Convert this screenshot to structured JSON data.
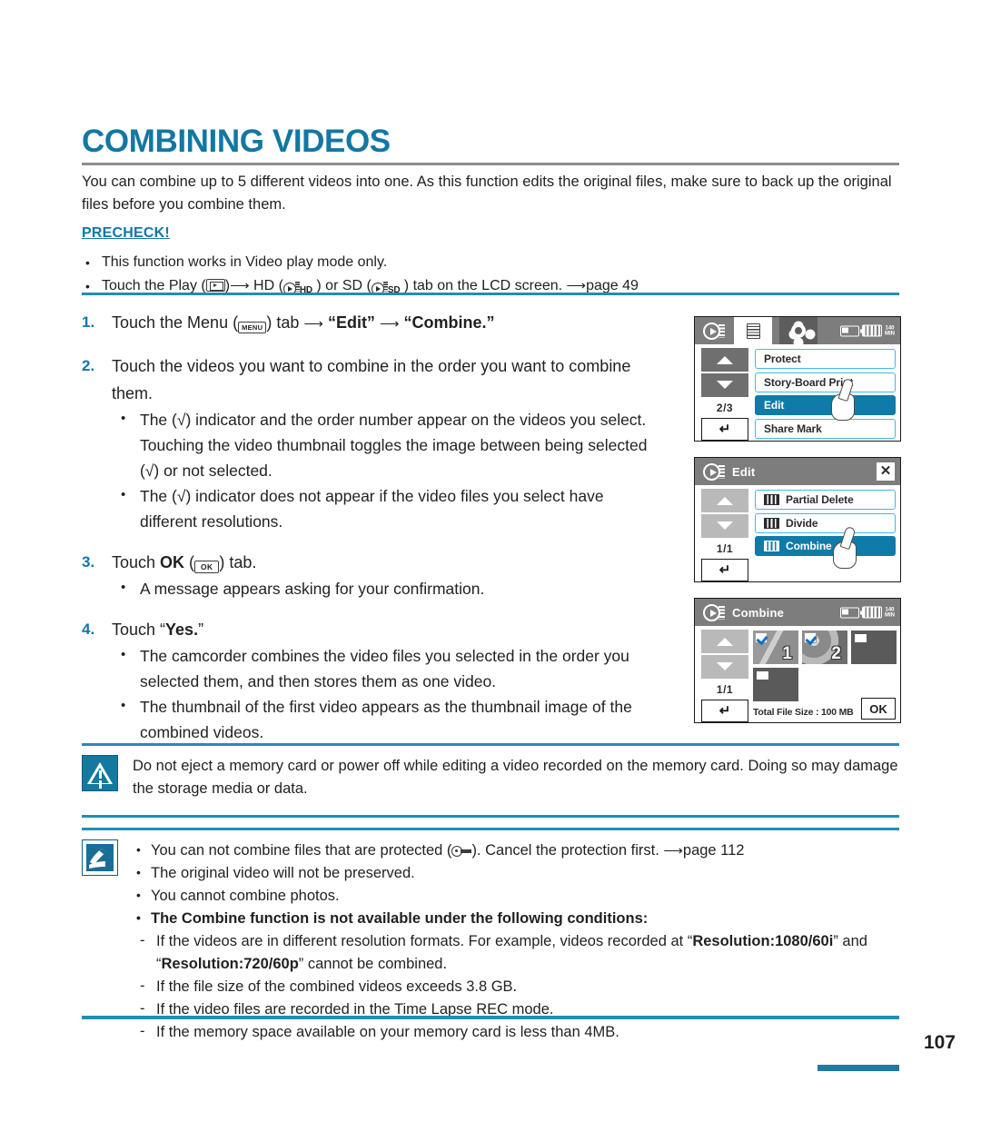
{
  "page": {
    "title": "COMBINING VIDEOS",
    "number": "107",
    "intro": "You can combine up to 5 different videos into one. As this function edits the original files, make sure to back up the original files before you combine them."
  },
  "precheck": {
    "heading": "PRECHECK!",
    "items": [
      {
        "pre": "This function works in Video play mode only.",
        "type": "plain"
      },
      {
        "type": "rich",
        "parts": [
          "Touch the Play (",
          ")",
          " HD (",
          "HD",
          " ) or SD (",
          "SD",
          " ) tab on the LCD screen. ",
          "page 49"
        ]
      }
    ],
    "line1": "This function works in Video play mode only."
  },
  "steps": [
    {
      "num": "1.",
      "text_a": "Touch the Menu (",
      "menu_icon_label": "MENU",
      "text_b": ") tab ",
      "bold_a": "“Edit”",
      "text_c": " ",
      "bold_b": "“Combine.”"
    },
    {
      "num": "2.",
      "text": "Touch the videos you want to combine in the order you want to combine them.",
      "bullets": [
        "The (√) indicator and the order number appear on the videos you select. Touching the video thumbnail toggles the image between being selected (√) or not selected.",
        "The (√) indicator does not appear if the video files you select have different resolutions."
      ]
    },
    {
      "num": "3.",
      "text_a": "Touch ",
      "bold_a": "OK",
      "text_b": " (",
      "ok_icon_label": "OK",
      "text_c": ") tab.",
      "bullets": [
        "A message appears asking for your confirmation."
      ]
    },
    {
      "num": "4.",
      "text_a": "Touch “",
      "bold_a": "Yes.",
      "text_b": "”",
      "bullets": [
        "The camcorder combines the video files you selected in the order you selected them, and then stores them as one video.",
        "The thumbnail of the first video appears as the thumbnail image of the combined videos."
      ]
    }
  ],
  "screens": [
    {
      "id": "menu-screen",
      "title": "",
      "page_indicator": "2/3",
      "items": [
        {
          "label": "Protect",
          "selected": false,
          "icon": false
        },
        {
          "label": "Story-Board Print",
          "selected": false,
          "icon": false
        },
        {
          "label": "Edit",
          "selected": true,
          "icon": false
        },
        {
          "label": "Share Mark",
          "selected": false,
          "icon": false
        }
      ],
      "memory_time": "140 MIN"
    },
    {
      "id": "edit-screen",
      "title": "Edit",
      "page_indicator": "1/1",
      "items": [
        {
          "label": "Partial Delete",
          "selected": false,
          "icon": true
        },
        {
          "label": "Divide",
          "selected": false,
          "icon": true
        },
        {
          "label": "Combine",
          "selected": true,
          "icon": true
        }
      ]
    },
    {
      "id": "combine-screen",
      "title": "Combine",
      "page_indicator": "1/1",
      "total_file_size": "Total File Size : 100 MB",
      "ok_label": "OK",
      "thumbnails": [
        {
          "number": "1",
          "checked": true
        },
        {
          "number": "2",
          "checked": true
        },
        {
          "number": "",
          "checked": false
        },
        {
          "number": "",
          "checked": false
        }
      ],
      "memory_time": "140 MIN"
    }
  ],
  "caution": {
    "text": "Do not eject a memory card or power off while editing a video recorded on the memory card. Doing so may damage the storage media or data."
  },
  "notes": {
    "items": [
      {
        "text_a": "You can not combine files that are protected (",
        "text_b": "). Cancel the protection first. ",
        "text_c": "page 112",
        "has_key_icon": true,
        "bold": false
      },
      {
        "text_a": "The original video will not be preserved.",
        "bold": false
      },
      {
        "text_a": "You cannot combine photos.",
        "bold": false
      },
      {
        "text_a": "The Combine function is not available under the following conditions:",
        "bold": true
      }
    ],
    "conditions": [
      {
        "text_a": "If the videos are in different resolution formats. For example, videos recorded at “",
        "bold_a": "Resolution:1080/60i",
        "text_b": "” and “",
        "bold_b": "Resolution:720/60p",
        "text_c": "” cannot be combined."
      },
      {
        "text_a": "If the file size of the combined videos exceeds 3.8 GB."
      },
      {
        "text_a": "If the video files are recorded in the Time Lapse REC mode."
      },
      {
        "text_a": "If the memory space available on your memory card is less than 4MB."
      }
    ]
  },
  "colors": {
    "accent": "#1277a3",
    "rule": "#1f8fb5",
    "selected": "#0f7ba8"
  }
}
